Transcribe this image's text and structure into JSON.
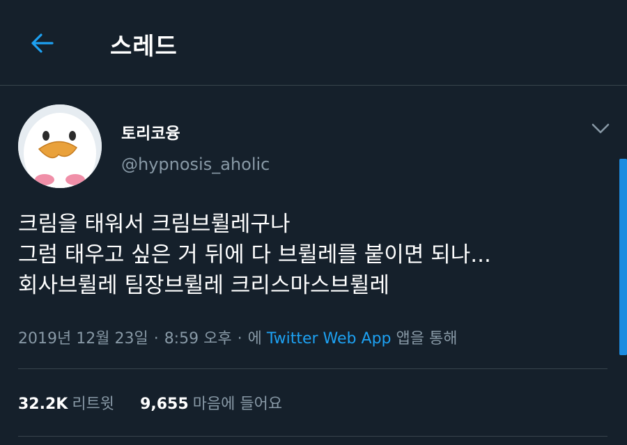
{
  "header": {
    "title": "스레드",
    "back_icon": "arrow-left-icon"
  },
  "tweet": {
    "display_name": "토리코융",
    "handle": "@hypnosis_aholic",
    "text_lines": [
      "크림을 태워서 크림브륄레구나",
      "그럼 태우고 싶은 거 뒤에 다 브륄레를 붙이면 되나...",
      "회사브륄레 팀장브륄레 크리스마스브륄레"
    ],
    "meta": {
      "date_time": "2019년 12월 23일",
      "sep": "·",
      "time": "8:59 오후",
      "via_prefix": "에",
      "source": "Twitter Web App",
      "via_suffix": "앱을 통해"
    },
    "stats": {
      "retweets_count": "32.2K",
      "retweets_label": "리트윗",
      "likes_count": "9,655",
      "likes_label": "마음에 들어요"
    }
  },
  "colors": {
    "background": "#15202b",
    "accent": "#1da1f2",
    "secondary_text": "#8899a6",
    "border": "#38444d"
  }
}
